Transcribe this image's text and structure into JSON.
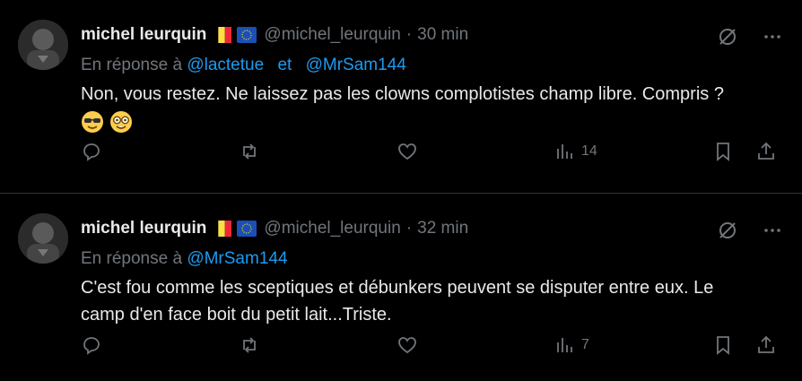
{
  "tweets": [
    {
      "name": "michel leurquin",
      "handle": "@michel_leurquin",
      "dot": "·",
      "time": "30 min",
      "reply_prefix": "En réponse à",
      "mentions": [
        "@lactetue",
        "@MrSam144"
      ],
      "reply_join": "et",
      "text": "Non, vous restez. Ne laissez pas les clowns complotistes champ libre. Compris ?",
      "emojis": [
        "smiling-face-with-sunglasses",
        "nerd-face"
      ],
      "views": "14"
    },
    {
      "name": "michel leurquin",
      "handle": "@michel_leurquin",
      "dot": "·",
      "time": "32 min",
      "reply_prefix": "En réponse à",
      "mentions": [
        "@MrSam144"
      ],
      "text": "C'est fou comme les sceptiques et débunkers peuvent se disputer entre eux. Le camp d'en face boit du petit lait...Triste.",
      "views": "7"
    }
  ],
  "colors": {
    "background": "#000000",
    "text": "#e7e9ea",
    "muted": "#71767b",
    "link": "#1d9bf0",
    "divider": "#2f3336"
  },
  "icons": [
    "grok-icon",
    "more-icon",
    "reply-icon",
    "retweet-icon",
    "like-icon",
    "views-icon",
    "bookmark-icon",
    "share-icon",
    "belgium-flag-icon",
    "eu-flag-icon"
  ]
}
